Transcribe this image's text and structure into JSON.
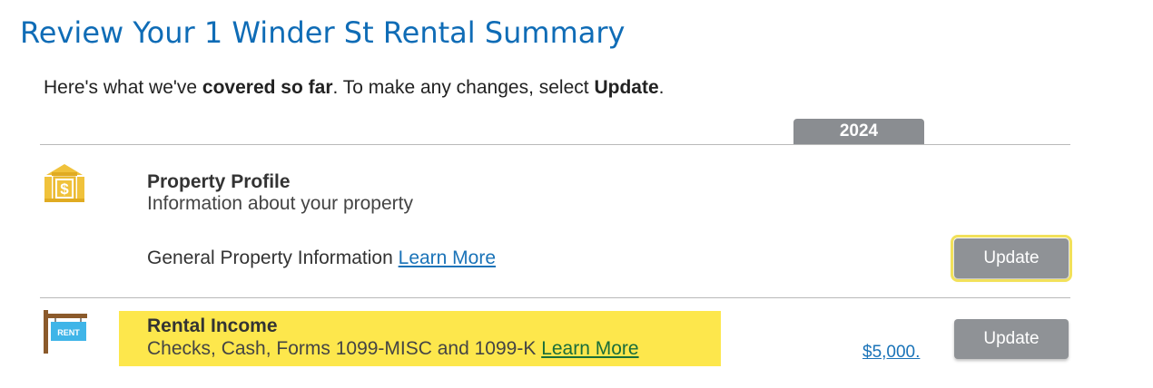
{
  "page_title": "Review Your 1 Winder St Rental Summary",
  "intro": {
    "prefix": "Here's what we've ",
    "bold1": "covered so far",
    "middle": ". To make any changes, select ",
    "bold2": "Update",
    "suffix": "."
  },
  "year_column": "2024",
  "sections": [
    {
      "icon": "bank-building-dollar-icon",
      "title": "Property Profile",
      "subtitle": "Information about your property",
      "line_label": "General Property Information",
      "learn_more": "Learn More",
      "amount": "",
      "update_label": "Update"
    },
    {
      "icon": "rent-sign-icon",
      "title": "Rental Income",
      "subtitle": "Checks, Cash, Forms 1099-MISC and 1099-K",
      "learn_more": "Learn More",
      "amount": "$5,000.",
      "update_label": "Update",
      "icon_text": "RENT"
    }
  ],
  "colors": {
    "title": "#0f6cb6",
    "button": "#8f9296",
    "highlight": "#fde74c",
    "icon_gold": "#f0c23b",
    "rent_sign": "#3fb5e8"
  }
}
